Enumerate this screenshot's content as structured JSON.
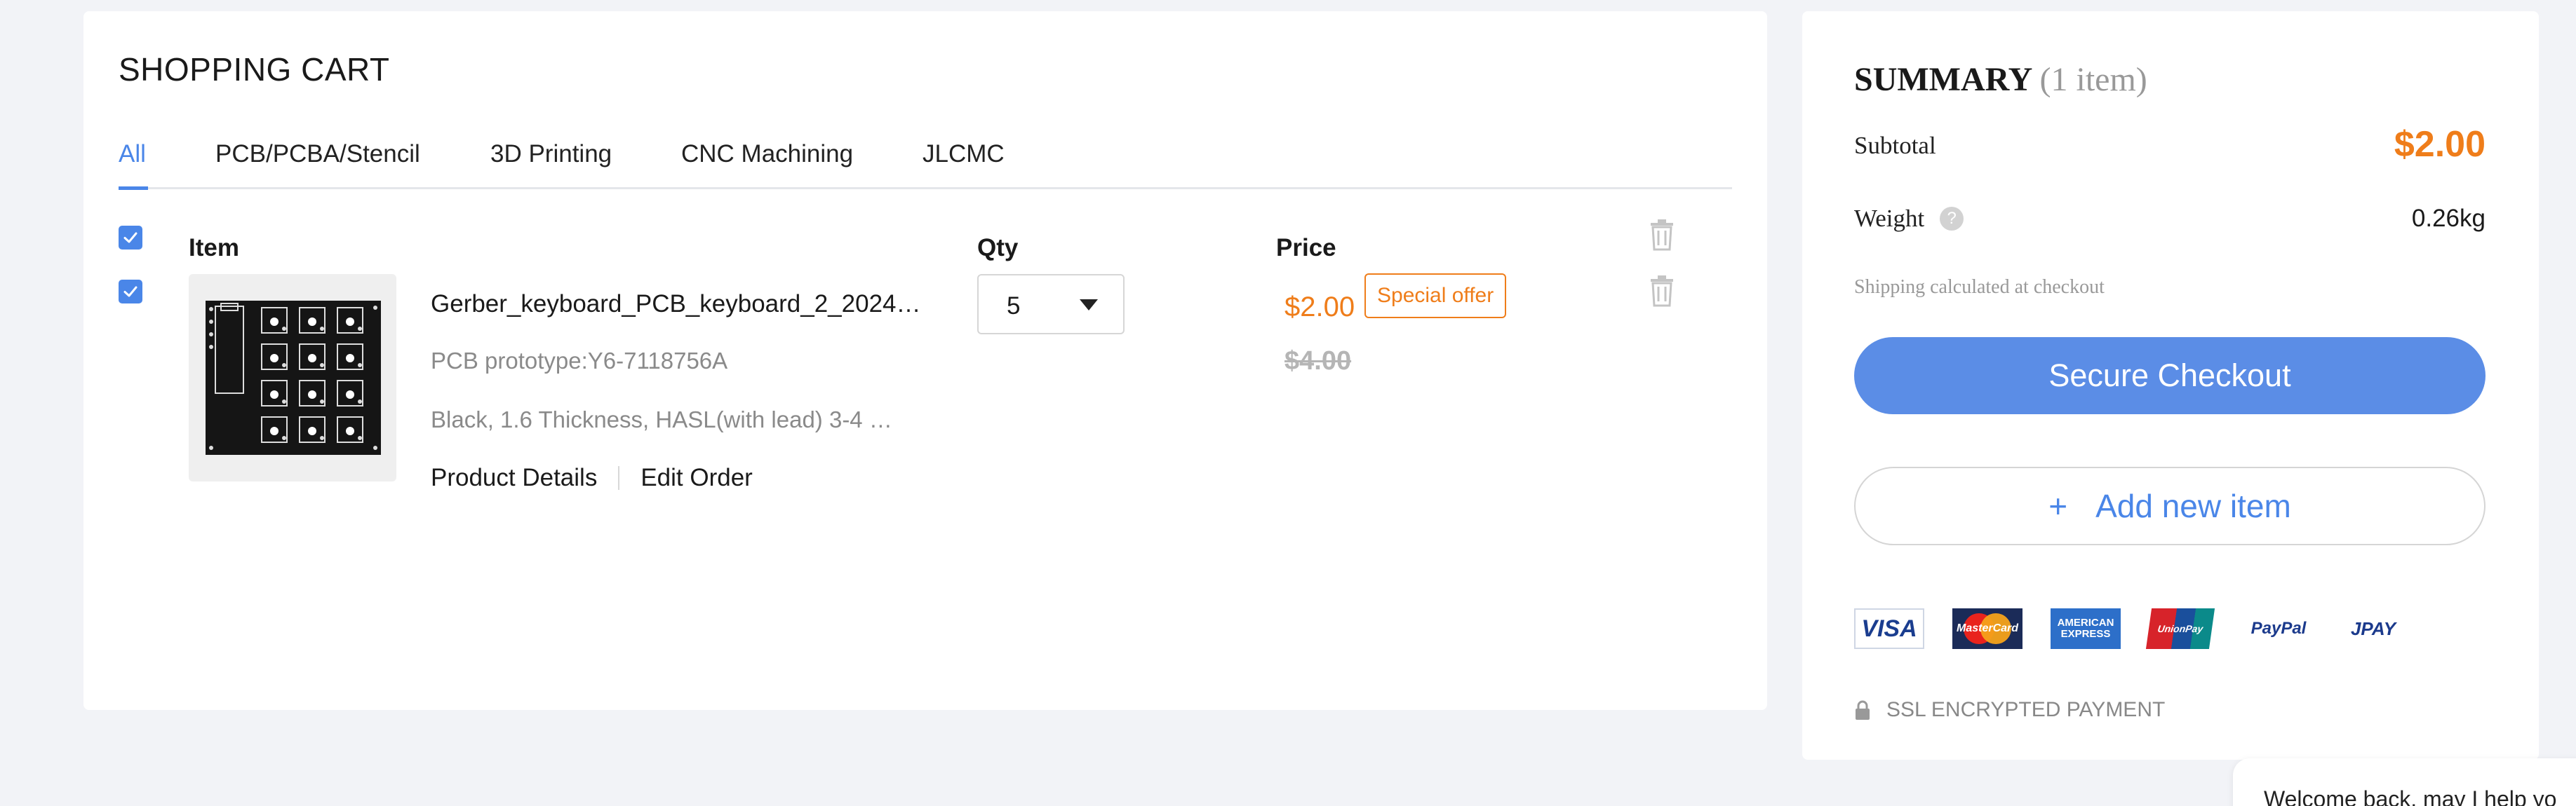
{
  "cart": {
    "title": "SHOPPING CART",
    "tabs": [
      {
        "label": "All",
        "active": true
      },
      {
        "label": "PCB/PCBA/Stencil",
        "active": false
      },
      {
        "label": "3D Printing",
        "active": false
      },
      {
        "label": "CNC Machining",
        "active": false
      },
      {
        "label": "JLCMC",
        "active": false
      }
    ],
    "headers": {
      "item": "Item",
      "qty": "Qty",
      "price": "Price"
    },
    "select_all_checked": true,
    "items": [
      {
        "checked": true,
        "name": "Gerber_keyboard_PCB_keyboard_2_2024…",
        "sub": "PCB prototype:Y6-7118756A",
        "spec": "Black, 1.6 Thickness, HASL(with lead) 3-4 …",
        "qty": "5",
        "price": "$2.00",
        "badge": "Special offer",
        "old_price": "$4.00",
        "links": {
          "details": "Product Details",
          "edit": "Edit Order"
        }
      }
    ]
  },
  "summary": {
    "title": "SUMMARY",
    "count": "(1 item)",
    "subtotal_label": "Subtotal",
    "subtotal_value": "$2.00",
    "weight_label": "Weight",
    "weight_help": "?",
    "weight_value": "0.26kg",
    "shipping_note": "Shipping calculated at checkout",
    "checkout_label": "Secure Checkout",
    "add_label": "Add new item",
    "add_plus": "+",
    "payments": [
      "VISA",
      "MasterCard",
      "AMERICAN EXPRESS",
      "UnionPay",
      "PayPal",
      "JPAY"
    ],
    "ssl_label": "SSL ENCRYPTED PAYMENT"
  },
  "chat": {
    "text": "Welcome back, may I help yo"
  },
  "colors": {
    "accent": "#4a86e8",
    "price": "#ef7d1a",
    "checkout": "#5b8de6",
    "background": "#f2f3f7"
  },
  "icons": {
    "checkbox": "checkmark-icon",
    "delete": "trash-icon",
    "dropdown": "chevron-down-icon",
    "help": "question-icon",
    "lock": "lock-icon"
  }
}
